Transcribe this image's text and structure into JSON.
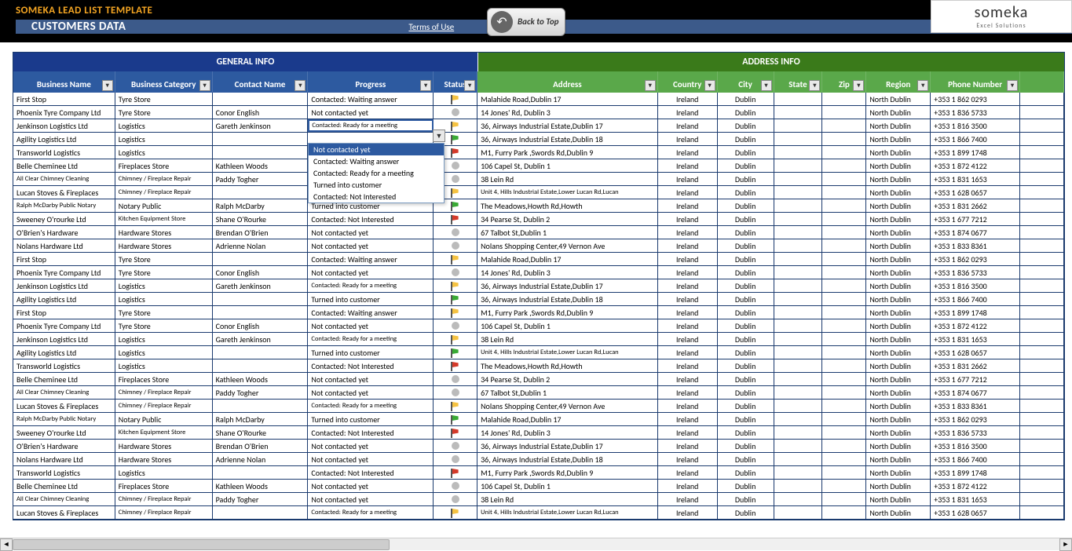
{
  "template_title": "SOMEKA LEAD LIST TEMPLATE",
  "subtitle": "CUSTOMERS DATA",
  "terms_link": "Terms of Use",
  "back_to_top": "Back to Top",
  "logo": {
    "main": "someka",
    "sub": "Excel Solutions"
  },
  "sections": {
    "general": "GENERAL INFO",
    "address": "ADDRESS INFO"
  },
  "columns": [
    "Business Name",
    "Business Category",
    "Contact Name",
    "Progress",
    "Status",
    "Address",
    "Country",
    "City",
    "State",
    "Zip",
    "Region",
    "Phone Number"
  ],
  "dropdown": {
    "selected_index": 0,
    "items": [
      "Not contacted yet",
      "Contacted: Waiting answer",
      "Contacted: Ready for a meeting",
      "Turned into customer",
      "Contacted: Not Interested"
    ]
  },
  "rows": [
    {
      "bn": "First Stop",
      "bc": "Tyre Store",
      "cn": "",
      "pr": "Contacted: Waiting answer",
      "st": "yellow",
      "ad": "Malahide Road,Dublin 17",
      "co": "Ireland",
      "ci": "Dublin",
      "rg": "North Dublin",
      "ph": "+353 1 862 0293"
    },
    {
      "bn": "Phoenix Tyre Company Ltd",
      "bc": "Tyre Store",
      "cn": "Conor English",
      "pr": "Not contacted yet",
      "st": "dot",
      "ad": "14 Jones' Rd, Dublin 3",
      "co": "Ireland",
      "ci": "Dublin",
      "rg": "North Dublin",
      "ph": "+353 1 836 5733"
    },
    {
      "bn": "Jenkinson Logistics Ltd",
      "bc": "Logistics",
      "cn": "Gareth Jenkinson",
      "pr": "Contacted: Ready for a meeting",
      "st": "yellow",
      "ad": "36, Airways Industrial Estate,Dublin 17",
      "co": "Ireland",
      "ci": "Dublin",
      "rg": "North Dublin",
      "ph": "+353 1 816 3500",
      "dd": true,
      "small_pr": true
    },
    {
      "bn": "Agility Logistics Ltd",
      "bc": "Logistics",
      "cn": "",
      "pr": "",
      "st": "green",
      "ad": "36, Airways Industrial Estate,Dublin 18",
      "co": "Ireland",
      "ci": "Dublin",
      "rg": "North Dublin",
      "ph": "+353 1 866 7400"
    },
    {
      "bn": "Transworld Logistics",
      "bc": "Logistics",
      "cn": "",
      "pr": "",
      "st": "red",
      "ad": "M1, Furry Park ,Swords Rd,Dublin 9",
      "co": "Ireland",
      "ci": "Dublin",
      "rg": "North Dublin",
      "ph": "+353 1 899 1748"
    },
    {
      "bn": "Belle Cheminee Ltd",
      "bc": "Fireplaces Store",
      "cn": "Kathleen Woods",
      "pr": "",
      "st": "dot",
      "ad": "106 Capel St, Dublin 1",
      "co": "Ireland",
      "ci": "Dublin",
      "rg": "North Dublin",
      "ph": "+353 1 872 4122"
    },
    {
      "bn": "All Clear Chimney Cleaning",
      "bc": "Chimney / Fireplace Repair",
      "cn": "Paddy Togher",
      "pr": "Not contacted yet",
      "st": "dot",
      "ad": "38 Lein Rd",
      "co": "Ireland",
      "ci": "Dublin",
      "rg": "North Dublin",
      "ph": "+353 1 831 1653",
      "small_bn": true,
      "small_bc": true
    },
    {
      "bn": "Lucan Stoves & Fireplaces",
      "bc": "Chimney / Fireplace Repair",
      "cn": "",
      "pr": "Contacted: Ready for a meeting",
      "st": "yellow",
      "ad": "Unit 4, Hills Industrial Estate,Lower Lucan Rd,Lucan",
      "co": "Ireland",
      "ci": "Dublin",
      "rg": "North Dublin",
      "ph": "+353 1 628 0657",
      "small_bc": true,
      "small_pr": true,
      "small_ad": true
    },
    {
      "bn": "Ralph McDarby Public Notary",
      "bc": "Notary Public",
      "cn": "Ralph McDarby",
      "pr": "Turned into customer",
      "st": "green",
      "ad": "The Meadows,Howth Rd,Howth",
      "co": "Ireland",
      "ci": "Dublin",
      "rg": "North Dublin",
      "ph": "+353 1 831 2662",
      "small_bn": true
    },
    {
      "bn": "Sweeney O'rourke Ltd",
      "bc": "Kitchen Equipment Store",
      "cn": "Shane O'Rourke",
      "pr": "Contacted: Not Interested",
      "st": "red",
      "ad": "34 Pearse St, Dublin 2",
      "co": "Ireland",
      "ci": "Dublin",
      "rg": "North Dublin",
      "ph": "+353 1 677 7212",
      "small_bc": true
    },
    {
      "bn": "O'Brien's Hardware",
      "bc": "Hardware Stores",
      "cn": "Brendan O'Brien",
      "pr": "Not contacted yet",
      "st": "dot",
      "ad": "67 Talbot St,Dublin 1",
      "co": "Ireland",
      "ci": "Dublin",
      "rg": "North Dublin",
      "ph": "+353 1 874 0677"
    },
    {
      "bn": "Nolans Hardware Ltd",
      "bc": "Hardware Stores",
      "cn": "Adrienne Nolan",
      "pr": "Not contacted yet",
      "st": "dot",
      "ad": "Nolans Shopping Center,49 Vernon Ave",
      "co": "Ireland",
      "ci": "Dublin",
      "rg": "North Dublin",
      "ph": "+353 1 833 8361"
    },
    {
      "bn": "First Stop",
      "bc": "Tyre Store",
      "cn": "",
      "pr": "Contacted: Waiting answer",
      "st": "yellow",
      "ad": "Malahide Road,Dublin 17",
      "co": "Ireland",
      "ci": "Dublin",
      "rg": "North Dublin",
      "ph": "+353 1 862 0293"
    },
    {
      "bn": "Phoenix Tyre Company Ltd",
      "bc": "Tyre Store",
      "cn": "Conor English",
      "pr": "Not contacted yet",
      "st": "dot",
      "ad": "14 Jones' Rd, Dublin 3",
      "co": "Ireland",
      "ci": "Dublin",
      "rg": "North Dublin",
      "ph": "+353 1 836 5733"
    },
    {
      "bn": "Jenkinson Logistics Ltd",
      "bc": "Logistics",
      "cn": "Gareth Jenkinson",
      "pr": "Contacted: Ready for a meeting",
      "st": "yellow",
      "ad": "36, Airways Industrial Estate,Dublin 17",
      "co": "Ireland",
      "ci": "Dublin",
      "rg": "North Dublin",
      "ph": "+353 1 816 3500",
      "small_pr": true
    },
    {
      "bn": "Agility Logistics Ltd",
      "bc": "Logistics",
      "cn": "",
      "pr": "Turned into customer",
      "st": "green",
      "ad": "36, Airways Industrial Estate,Dublin 18",
      "co": "Ireland",
      "ci": "Dublin",
      "rg": "North Dublin",
      "ph": "+353 1 866 7400"
    },
    {
      "bn": "First Stop",
      "bc": "Tyre Store",
      "cn": "",
      "pr": "Contacted: Waiting answer",
      "st": "yellow",
      "ad": "M1, Furry Park ,Swords Rd,Dublin 9",
      "co": "Ireland",
      "ci": "Dublin",
      "rg": "North Dublin",
      "ph": "+353 1 899 1748"
    },
    {
      "bn": "Phoenix Tyre Company Ltd",
      "bc": "Tyre Store",
      "cn": "Conor English",
      "pr": "Not contacted yet",
      "st": "dot",
      "ad": "106 Capel St, Dublin 1",
      "co": "Ireland",
      "ci": "Dublin",
      "rg": "North Dublin",
      "ph": "+353 1 872 4122"
    },
    {
      "bn": "Jenkinson Logistics Ltd",
      "bc": "Logistics",
      "cn": "Gareth Jenkinson",
      "pr": "Contacted: Ready for a meeting",
      "st": "yellow",
      "ad": "38 Lein Rd",
      "co": "Ireland",
      "ci": "Dublin",
      "rg": "North Dublin",
      "ph": "+353 1 831 1653",
      "small_pr": true
    },
    {
      "bn": "Agility Logistics Ltd",
      "bc": "Logistics",
      "cn": "",
      "pr": "Turned into customer",
      "st": "green",
      "ad": "Unit 4, Hills Industrial Estate,Lower Lucan Rd,Lucan",
      "co": "Ireland",
      "ci": "Dublin",
      "rg": "North Dublin",
      "ph": "+353 1 628 0657",
      "small_ad": true
    },
    {
      "bn": "Transworld Logistics",
      "bc": "Logistics",
      "cn": "",
      "pr": "Contacted: Not Interested",
      "st": "red",
      "ad": "The Meadows,Howth Rd,Howth",
      "co": "Ireland",
      "ci": "Dublin",
      "rg": "North Dublin",
      "ph": "+353 1 831 2662"
    },
    {
      "bn": "Belle Cheminee Ltd",
      "bc": "Fireplaces Store",
      "cn": "Kathleen Woods",
      "pr": "Not contacted yet",
      "st": "dot",
      "ad": "34 Pearse St, Dublin 2",
      "co": "Ireland",
      "ci": "Dublin",
      "rg": "North Dublin",
      "ph": "+353 1 677 7212"
    },
    {
      "bn": "All Clear Chimney Cleaning",
      "bc": "Chimney / Fireplace Repair",
      "cn": "Paddy Togher",
      "pr": "Not contacted yet",
      "st": "dot",
      "ad": "67 Talbot St,Dublin 1",
      "co": "Ireland",
      "ci": "Dublin",
      "rg": "North Dublin",
      "ph": "+353 1 874 0677",
      "small_bn": true,
      "small_bc": true
    },
    {
      "bn": "Lucan Stoves & Fireplaces",
      "bc": "Chimney / Fireplace Repair",
      "cn": "",
      "pr": "Contacted: Ready for a meeting",
      "st": "yellow",
      "ad": "Nolans Shopping Center,49 Vernon Ave",
      "co": "Ireland",
      "ci": "Dublin",
      "rg": "North Dublin",
      "ph": "+353 1 833 8361",
      "small_bc": true,
      "small_pr": true
    },
    {
      "bn": "Ralph McDarby Public Notary",
      "bc": "Notary Public",
      "cn": "Ralph McDarby",
      "pr": "Turned into customer",
      "st": "green",
      "ad": "Malahide Road,Dublin 17",
      "co": "Ireland",
      "ci": "Dublin",
      "rg": "North Dublin",
      "ph": "+353 1 862 0293",
      "small_bn": true
    },
    {
      "bn": "Sweeney O'rourke Ltd",
      "bc": "Kitchen Equipment Store",
      "cn": "Shane O'Rourke",
      "pr": "Contacted: Not Interested",
      "st": "red",
      "ad": "14 Jones' Rd, Dublin 3",
      "co": "Ireland",
      "ci": "Dublin",
      "rg": "North Dublin",
      "ph": "+353 1 836 5733",
      "small_bc": true
    },
    {
      "bn": "O'Brien's Hardware",
      "bc": "Hardware Stores",
      "cn": "Brendan O'Brien",
      "pr": "Not contacted yet",
      "st": "dot",
      "ad": "36, Airways Industrial Estate,Dublin 17",
      "co": "Ireland",
      "ci": "Dublin",
      "rg": "North Dublin",
      "ph": "+353 1 816 3500"
    },
    {
      "bn": "Nolans Hardware Ltd",
      "bc": "Hardware Stores",
      "cn": "Adrienne Nolan",
      "pr": "Not contacted yet",
      "st": "dot",
      "ad": "36, Airways Industrial Estate,Dublin 18",
      "co": "Ireland",
      "ci": "Dublin",
      "rg": "North Dublin",
      "ph": "+353 1 866 7400"
    },
    {
      "bn": "Transworld Logistics",
      "bc": "Logistics",
      "cn": "",
      "pr": "Contacted: Not Interested",
      "st": "red",
      "ad": "M1, Furry Park ,Swords Rd,Dublin 9",
      "co": "Ireland",
      "ci": "Dublin",
      "rg": "North Dublin",
      "ph": "+353 1 899 1748"
    },
    {
      "bn": "Belle Cheminee Ltd",
      "bc": "Fireplaces Store",
      "cn": "Kathleen Woods",
      "pr": "Not contacted yet",
      "st": "dot",
      "ad": "106 Capel St, Dublin 1",
      "co": "Ireland",
      "ci": "Dublin",
      "rg": "North Dublin",
      "ph": "+353 1 872 4122"
    },
    {
      "bn": "All Clear Chimney Cleaning",
      "bc": "Chimney / Fireplace Repair",
      "cn": "Paddy Togher",
      "pr": "Not contacted yet",
      "st": "dot",
      "ad": "38 Lein Rd",
      "co": "Ireland",
      "ci": "Dublin",
      "rg": "North Dublin",
      "ph": "+353 1 831 1653",
      "small_bn": true,
      "small_bc": true
    },
    {
      "bn": "Lucan Stoves & Fireplaces",
      "bc": "Chimney / Fireplace Repair",
      "cn": "",
      "pr": "Contacted: Ready for a meeting",
      "st": "yellow",
      "ad": "Unit 4, Hills Industrial Estate,Lower Lucan Rd,Lucan",
      "co": "Ireland",
      "ci": "Dublin",
      "rg": "North Dublin",
      "ph": "+353 1 628 0657",
      "small_bc": true,
      "small_pr": true,
      "small_ad": true
    }
  ]
}
